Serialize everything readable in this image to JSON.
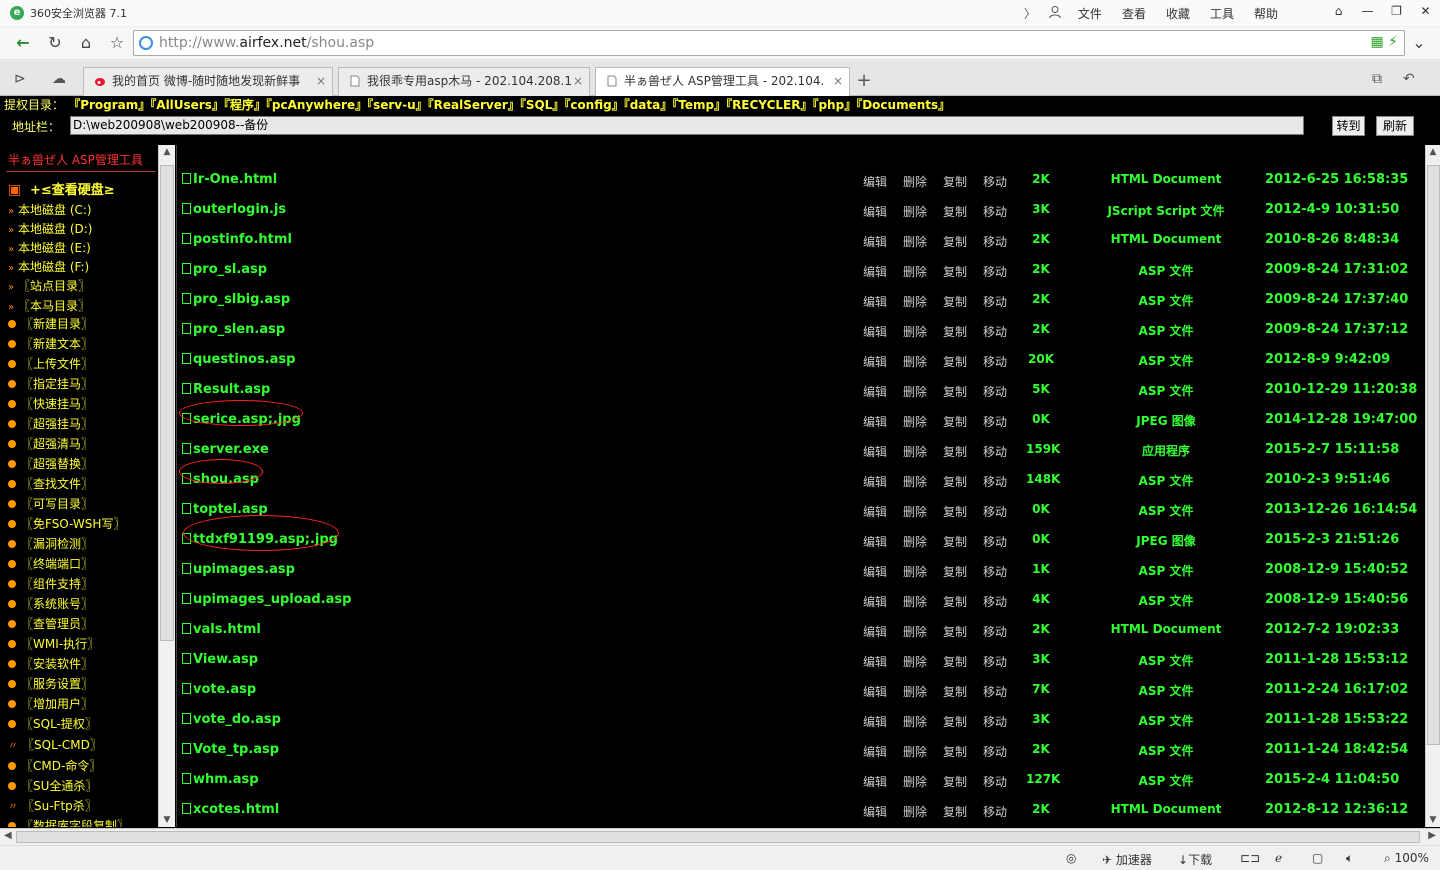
{
  "app": {
    "title": "360安全浏览器 7.1",
    "logo_char": "e",
    "menu": [
      "文件",
      "查看",
      "收藏",
      "工具",
      "帮助"
    ],
    "menu_icons": {
      "back": "〉",
      "user": "person-icon"
    },
    "window_controls": [
      "⌂",
      "—",
      "❐",
      "✕"
    ]
  },
  "nav": {
    "back": "←",
    "reload": "↻",
    "home": "⌂",
    "star": "☆",
    "url_prefix": "http://www.",
    "url_domain": "airfex.net",
    "url_path": "/shou.asp",
    "url_right_icons": "▦ ⚡",
    "dropdown": "⌄"
  },
  "tabs": {
    "left_icons": [
      "⊳",
      "☁"
    ],
    "items": [
      {
        "label": "我的首页 微博-随时随地发现新鲜事",
        "close": "×",
        "active": false
      },
      {
        "label": "我很乖专用asp木马 - 202.104.208.1",
        "close": "×",
        "active": false
      },
      {
        "label": "半ぁ兽ぜ人 ASP管理工具 - 202.104.",
        "close": "×",
        "active": true
      }
    ],
    "new_tab": "+",
    "right_icons": [
      "⧉",
      "↶"
    ]
  },
  "priv": {
    "label": "提权目录：",
    "dirs": [
      "『Program』",
      "『AllUsers』",
      "『程序』",
      "『pcAnywhere』",
      "『serv-u』",
      "『RealServer』",
      "『SQL』",
      "『config』",
      "『data』",
      "『Temp』",
      "『RECYCLER』",
      "『php』",
      "『Documents』"
    ]
  },
  "address": {
    "label": "地址栏：",
    "value": "D:\\web200908\\web200908--备份",
    "goto_label": "转到",
    "refresh_label": "刷新"
  },
  "left_panel": {
    "title": "半ぁ兽ぜ人 ASP管理工具",
    "header_item": "+≤查看硬盘≥",
    "drives": [
      "本地磁盘 (C:)",
      "本地磁盘 (D:)",
      "本地磁盘 (E:)",
      "本地磁盘 (F:)",
      "〖站点目录〗",
      "〖本马目录〗"
    ],
    "tools": [
      "〖新建目录〗",
      "〖新建文本〗",
      "〖上传文件〗",
      "〖指定挂马〗",
      "〖快速挂马〗",
      "〖超强挂马〗",
      "〖超强清马〗",
      "〖超强替换〗",
      "〖查找文件〗",
      "〖可写目录〗",
      "〖免FSO-WSH写〗",
      "〖漏洞检测〗",
      "〖终端端口〗",
      "〖组件支持〗",
      "〖系统账号〗",
      "〖查管理员〗",
      "〖WMI-执行〗",
      "〖安装软件〗",
      "〖服务设置〗",
      "〖增加用户〗",
      "〖SQL-提权〗"
    ],
    "tools2": [
      "〖SQL-CMD〗",
      "〖CMD-命令〗",
      "〖SU全通杀〗",
      "〖Su-Ftp杀〗",
      "〖数据库字段复制〗"
    ]
  },
  "files": {
    "ops": [
      "编辑",
      "删除",
      "复制",
      "移动"
    ],
    "rows": [
      {
        "name": "Ir-One.html",
        "size": "2K",
        "type": "HTML Document",
        "date": "2012-6-25 16:58:35"
      },
      {
        "name": "outerlogin.js",
        "size": "3K",
        "type": "JScript Script 文件",
        "date": "2012-4-9 10:31:50"
      },
      {
        "name": "postinfo.html",
        "size": "2K",
        "type": "HTML Document",
        "date": "2010-8-26 8:48:34"
      },
      {
        "name": "pro_sl.asp",
        "size": "2K",
        "type": "ASP 文件",
        "date": "2009-8-24 17:31:02"
      },
      {
        "name": "pro_slbig.asp",
        "size": "2K",
        "type": "ASP 文件",
        "date": "2009-8-24 17:37:40"
      },
      {
        "name": "pro_slen.asp",
        "size": "2K",
        "type": "ASP 文件",
        "date": "2009-8-24 17:37:12"
      },
      {
        "name": "questinos.asp",
        "size": "20K",
        "type": "ASP 文件",
        "date": "2012-8-9 9:42:09"
      },
      {
        "name": "Result.asp",
        "size": "5K",
        "type": "ASP 文件",
        "date": "2010-12-29 11:20:38"
      },
      {
        "name": "serice.asp;.jpg",
        "size": "0K",
        "type": "JPEG 图像",
        "date": "2014-12-28 19:47:00"
      },
      {
        "name": "server.exe",
        "size": "159K",
        "type": "应用程序",
        "date": "2015-2-7 15:11:58"
      },
      {
        "name": "shou.asp",
        "size": "148K",
        "type": "ASP 文件",
        "date": "2010-2-3 9:51:46"
      },
      {
        "name": "toptel.asp",
        "size": "0K",
        "type": "ASP 文件",
        "date": "2013-12-26 16:14:54"
      },
      {
        "name": "ttdxf91199.asp;.jpg",
        "size": "0K",
        "type": "JPEG 图像",
        "date": "2015-2-3 21:51:26"
      },
      {
        "name": "upimages.asp",
        "size": "1K",
        "type": "ASP 文件",
        "date": "2008-12-9 15:40:52"
      },
      {
        "name": "upimages_upload.asp",
        "size": "4K",
        "type": "ASP 文件",
        "date": "2008-12-9 15:40:56"
      },
      {
        "name": "vals.html",
        "size": "2K",
        "type": "HTML Document",
        "date": "2012-7-2 19:02:33"
      },
      {
        "name": "View.asp",
        "size": "3K",
        "type": "ASP 文件",
        "date": "2011-1-28 15:53:12"
      },
      {
        "name": "vote.asp",
        "size": "7K",
        "type": "ASP 文件",
        "date": "2011-2-24 16:17:02"
      },
      {
        "name": "vote_do.asp",
        "size": "3K",
        "type": "ASP 文件",
        "date": "2011-1-28 15:53:22"
      },
      {
        "name": "Vote_tp.asp",
        "size": "2K",
        "type": "ASP 文件",
        "date": "2011-1-24 18:42:54"
      },
      {
        "name": "whm.asp",
        "size": "127K",
        "type": "ASP 文件",
        "date": "2015-2-4 11:04:50"
      },
      {
        "name": "xcotes.html",
        "size": "2K",
        "type": "HTML Document",
        "date": "2012-8-12 12:36:12"
      }
    ]
  },
  "status": {
    "accelerator": "加速器",
    "download": "下载",
    "zoom": "100%"
  },
  "colors": {
    "bg": "#000000",
    "file_green": "#33ff33",
    "menu_yellow": "#ffff33",
    "highlight_red": "#ff2222"
  }
}
